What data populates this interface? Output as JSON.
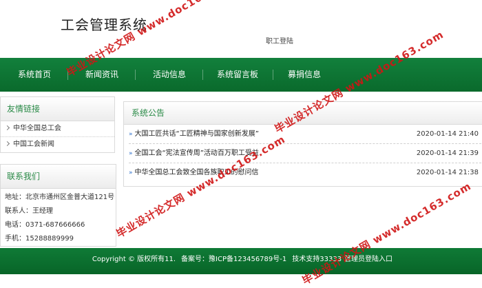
{
  "header": {
    "site_title": "工会管理系统",
    "login_link": "职工登陆"
  },
  "nav": {
    "items": [
      "系统首页",
      "新闻资讯",
      "活动信息",
      "系统留言板",
      "募捐信息"
    ]
  },
  "sidebar": {
    "links_title": "友情链接",
    "links": [
      "中华全国总工会",
      "中国工会新闻"
    ],
    "contact_title": "联系我们",
    "contact": {
      "address": "地址：北京市通州区金普大道121号",
      "person": "联系人：王经理",
      "phone": "电话：0371-687666666",
      "mobile": "手机：15288889999"
    }
  },
  "main": {
    "title": "系统公告",
    "announcements": [
      {
        "title": "大国工匠共话“工匠精神与国家创新发展”",
        "date": "2020-01-14 21:40"
      },
      {
        "title": "全国工会“宪法宣传周”活动百万职工受益",
        "date": "2020-01-14 21:39"
      },
      {
        "title": "中华全国总工会致全国各族职工的慰问信",
        "date": "2020-01-14 21:38"
      }
    ]
  },
  "footer": {
    "copyright": "Copyright © 版权所有11.",
    "icp": "备案号：豫ICP备123456789号-1",
    "support": "技术支持33333",
    "admin_login": "管理员登陆入口"
  },
  "watermark": {
    "text": "毕业设计论文网 www.doc163.com",
    "color": "#d01515"
  }
}
